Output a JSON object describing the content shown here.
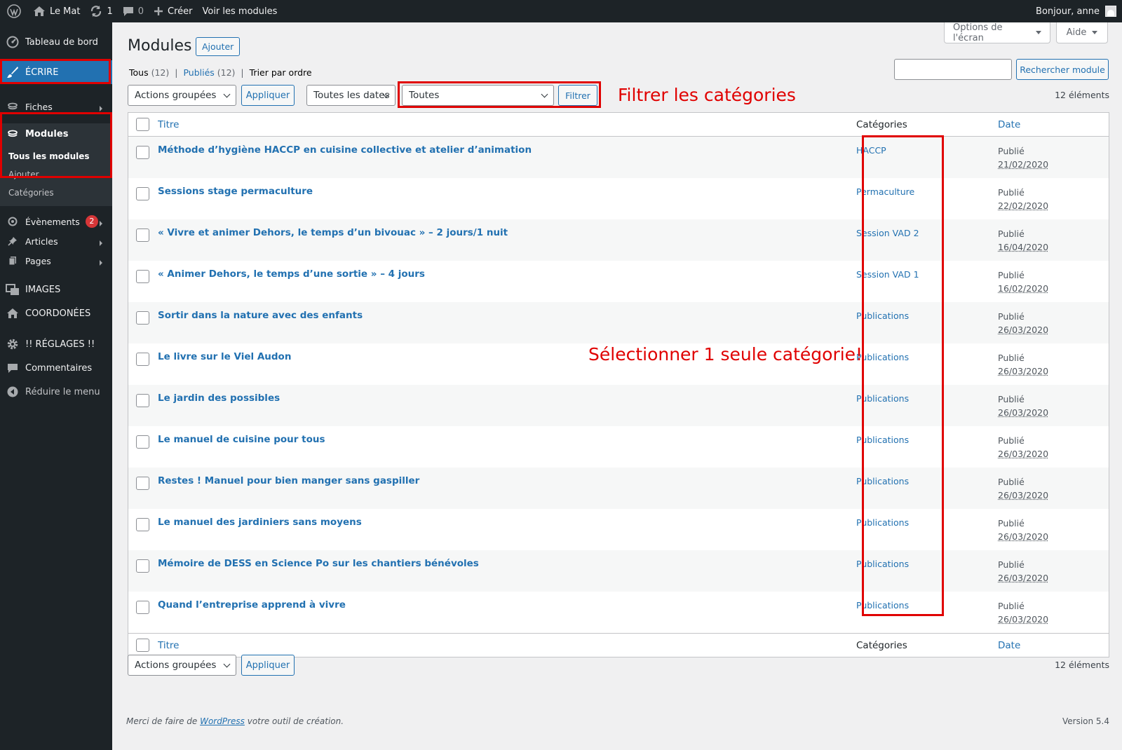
{
  "adminbar": {
    "site_name": "Le Mat",
    "updates_count": "1",
    "comments_count": "0",
    "new_label": "Créer",
    "view_label": "Voir les modules",
    "greeting": "Bonjour, anne"
  },
  "sidebar": {
    "dashboard": "Tableau de bord",
    "write": "ÉCRIRE",
    "fiches": "Fiches",
    "modules": "Modules",
    "modules_sub": {
      "all": "Tous les modules",
      "add": "Ajouter",
      "categories": "Catégories"
    },
    "events": "Évènements",
    "events_badge": "2",
    "articles": "Articles",
    "pages": "Pages",
    "images": "IMAGES",
    "contacts": "COORDONÉES",
    "settings": "!! RÉGLAGES !!",
    "comments": "Commentaires",
    "collapse": "Réduire le menu"
  },
  "screen_tabs": {
    "options": "Options de l'écran",
    "help": "Aide"
  },
  "page": {
    "title": "Modules",
    "add_button": "Ajouter",
    "views": {
      "all": "Tous",
      "all_count": "(12)",
      "published": "Publiés",
      "published_count": "(12)",
      "order": "Trier par ordre"
    },
    "search_placeholder": "",
    "search_button": "Rechercher module",
    "bulk_actions": "Actions groupées",
    "apply": "Appliquer",
    "dates": "Toutes les dates",
    "category_filter": "Toutes",
    "filter_button": "Filtrer",
    "item_count": "12 éléments"
  },
  "table": {
    "headers": {
      "title": "Titre",
      "categories": "Catégories",
      "date": "Date"
    },
    "rows": [
      {
        "title": "Méthode d’hygiène HACCP en cuisine collective et atelier d’animation",
        "category": "HACCP",
        "status": "Publié",
        "date": "21/02/2020"
      },
      {
        "title": "Sessions stage permaculture",
        "category": "Permaculture",
        "status": "Publié",
        "date": "22/02/2020"
      },
      {
        "title": "« Vivre et animer Dehors, le temps d’un bivouac » – 2 jours/1 nuit",
        "category": "Session VAD 2",
        "status": "Publié",
        "date": "16/04/2020"
      },
      {
        "title": "« Animer Dehors, le temps d’une sortie » – 4 jours",
        "category": "Session VAD 1",
        "status": "Publié",
        "date": "16/02/2020"
      },
      {
        "title": "Sortir dans la nature avec des enfants",
        "category": "Publications",
        "status": "Publié",
        "date": "26/03/2020"
      },
      {
        "title": "Le livre sur le Viel Audon",
        "category": "Publications",
        "status": "Publié",
        "date": "26/03/2020"
      },
      {
        "title": "Le jardin des possibles",
        "category": "Publications",
        "status": "Publié",
        "date": "26/03/2020"
      },
      {
        "title": "Le manuel de cuisine pour tous",
        "category": "Publications",
        "status": "Publié",
        "date": "26/03/2020"
      },
      {
        "title": "Restes ! Manuel pour bien manger sans gaspiller",
        "category": "Publications",
        "status": "Publié",
        "date": "26/03/2020"
      },
      {
        "title": "Le manuel des jardiniers sans moyens",
        "category": "Publications",
        "status": "Publié",
        "date": "26/03/2020"
      },
      {
        "title": "Mémoire de DESS en Science Po sur les chantiers bénévoles",
        "category": "Publications",
        "status": "Publié",
        "date": "26/03/2020"
      },
      {
        "title": "Quand l’entreprise apprend à vivre",
        "category": "Publications",
        "status": "Publié",
        "date": "26/03/2020"
      }
    ]
  },
  "annotations": {
    "filter_note": "Filtrer les catégories",
    "select_note": "Sélectionner 1 seule catégorie!",
    "color": "#e00000"
  },
  "footer": {
    "thanks_prefix": "Merci de faire de ",
    "thanks_link": "WordPress",
    "thanks_suffix": " votre outil de création.",
    "version": "Version 5.4"
  },
  "colors": {
    "adminbar": "#1d2327",
    "accent": "#2271b1",
    "background": "#f0f0f1"
  }
}
